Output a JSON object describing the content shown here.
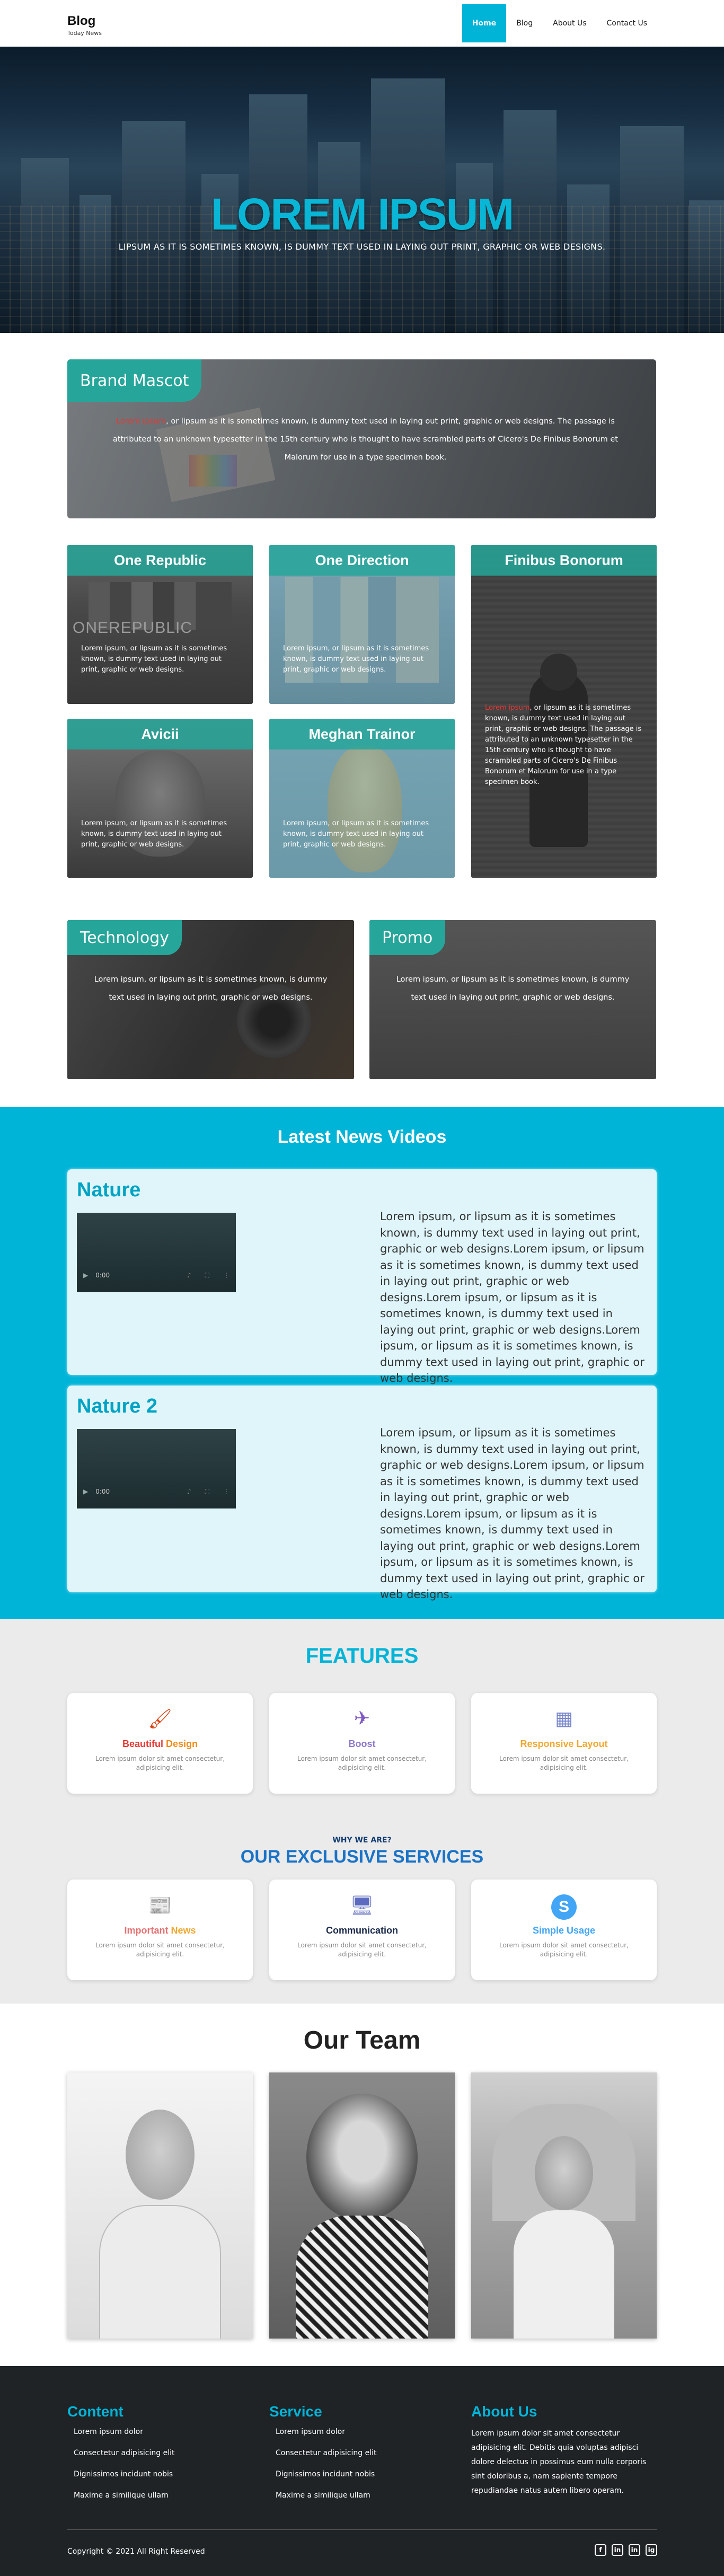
{
  "header": {
    "logo": "Blog",
    "tagline": "Today News",
    "nav": [
      "Home",
      "Blog",
      "About Us",
      "Contact Us"
    ],
    "active_nav": "Home"
  },
  "hero": {
    "title": "LOREM IPSUM",
    "subtitle": "LIPSUM AS IT IS SOMETIMES KNOWN, IS DUMMY TEXT USED IN LAYING OUT PRINT, GRAPHIC OR WEB DESIGNS."
  },
  "mascot": {
    "title": "Brand Mascot",
    "highlight": "Lorem ipsum",
    "text": ", or lipsum as it is sometimes known, is dummy text used in laying out print, graphic or web designs. The passage is attributed to an unknown typesetter in the 15th century who is thought to have scrambled parts of Cicero's De Finibus Bonorum et Malorum for use in a type specimen book."
  },
  "cards": {
    "one_republic": {
      "title": "One Republic",
      "logo_text": "ONEREPUBLIC",
      "text": "Lorem ipsum, or lipsum as it is sometimes known, is dummy text used in laying out print, graphic or web designs."
    },
    "one_direction": {
      "title": "One Direction",
      "text": "Lorem ipsum, or lipsum as it is sometimes known, is dummy text used in laying out print, graphic or web designs."
    },
    "finibus": {
      "title": "Finibus Bonorum",
      "highlight": "Lorem ipsum",
      "text": ", or lipsum as it is sometimes known, is dummy text used in laying out print, graphic or web designs. The passage is attributed to an unknown typesetter in the 15th century who is thought to have scrambled parts of Cicero's De Finibus Bonorum et Malorum for use in a type specimen book."
    },
    "avicii": {
      "title": "Avicii",
      "text": "Lorem ipsum, or lipsum as it is sometimes known, is dummy text used in laying out print, graphic or web designs."
    },
    "meghan": {
      "title": "Meghan Trainor",
      "text": "Lorem ipsum, or lipsum as it is sometimes known, is dummy text used in laying out print, graphic or web designs."
    },
    "technology": {
      "title": "Technology",
      "text": "Lorem ipsum, or lipsum as it is sometimes known, is dummy text used in laying out print, graphic or web designs."
    },
    "promo": {
      "title": "Promo",
      "text": "Lorem ipsum, or lipsum as it is sometimes known, is dummy text used in laying out print, graphic or web designs."
    }
  },
  "videos": {
    "heading": "Latest News Videos",
    "items": [
      {
        "title": "Nature",
        "time": "0:00",
        "text": "Lorem ipsum, or lipsum as it is sometimes known, is dummy text used in laying out print, graphic or web designs.Lorem ipsum, or lipsum as it is sometimes known, is dummy text used in laying out print, graphic or web designs.Lorem ipsum, or lipsum as it is sometimes known, is dummy text used in laying out print, graphic or web designs.Lorem ipsum, or lipsum as it is sometimes known, is dummy text used in laying out print, graphic or web designs."
      },
      {
        "title": "Nature 2",
        "time": "0:00",
        "text": "Lorem ipsum, or lipsum as it is sometimes known, is dummy text used in laying out print, graphic or web designs.Lorem ipsum, or lipsum as it is sometimes known, is dummy text used in laying out print, graphic or web designs.Lorem ipsum, or lipsum as it is sometimes known, is dummy text used in laying out print, graphic or web designs.Lorem ipsum, or lipsum as it is sometimes known, is dummy text used in laying out print, graphic or web designs."
      }
    ]
  },
  "features": {
    "heading": "FEATURES",
    "items": [
      {
        "title_a": "Beautiful",
        "title_b": " Design",
        "icon": "paintbrush-icon",
        "desc": "Lorem ipsum dolor sit amet consectetur, adipisicing elit."
      },
      {
        "title_a": "Boost",
        "title_b": "",
        "icon": "rocket-icon",
        "desc": "Lorem ipsum dolor sit amet consectetur, adipisicing elit."
      },
      {
        "title_a": "Responsive Layout",
        "title_b": "",
        "icon": "layout-icon",
        "desc": "Lorem ipsum dolor sit amet consectetur, adipisicing elit."
      }
    ],
    "why": "WHY WE ARE?",
    "services_heading": "OUR EXCLUSIVE SERVICES",
    "services": [
      {
        "title_a": "Important",
        "title_b": " News",
        "icon": "newspaper-icon",
        "desc": "Lorem ipsum dolor sit amet consectetur, adipisicing elit."
      },
      {
        "title_a": "Communication",
        "title_b": "",
        "icon": "monitor-icon",
        "desc": "Lorem ipsum dolor sit amet consectetur, adipisicing elit."
      },
      {
        "title_a": "Simple Usage",
        "title_b": "",
        "icon": "circle-s-icon",
        "desc": "Lorem ipsum dolor sit amet consectetur, adipisicing elit."
      }
    ]
  },
  "team": {
    "heading": "Our Team"
  },
  "footer": {
    "content": {
      "title": "Content",
      "items": [
        "Lorem ipsum dolor",
        "Consectetur adipisicing elit",
        "Dignissimos incidunt nobis",
        "Maxime a similique ullam"
      ]
    },
    "service": {
      "title": "Service",
      "items": [
        "Lorem ipsum dolor",
        "Consectetur adipisicing elit",
        "Dignissimos incidunt nobis",
        "Maxime a similique ullam"
      ]
    },
    "about": {
      "title": "About Us",
      "text": "Lorem ipsum dolor sit amet consectetur adipisicing elit. Debitis quia voluptas adipisci dolore delectus in possimus eum nulla corporis sint doloribus a, nam sapiente tempore repudiandae natus autem libero operam."
    },
    "copyright": "Copyright © 2021 All Right Reserved",
    "social": [
      "f",
      "in",
      "in",
      "ig"
    ]
  },
  "colors": {
    "accent": "#00b4d8",
    "teal": "#26a69a",
    "dark": "#1f2326"
  }
}
